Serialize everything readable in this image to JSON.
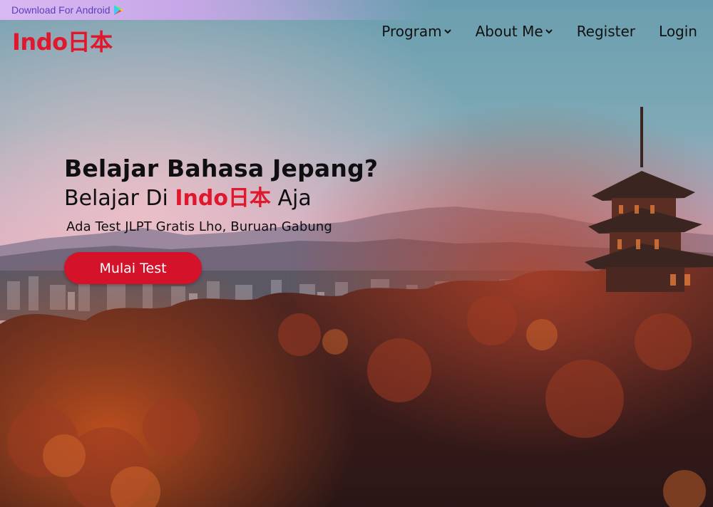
{
  "banner": {
    "label": "Download For Android",
    "icon": "google-play-icon"
  },
  "nav": {
    "logo": "Indo日本",
    "items": [
      {
        "label": "Program",
        "has_dropdown": true
      },
      {
        "label": "About Me",
        "has_dropdown": true
      },
      {
        "label": "Register",
        "has_dropdown": false
      },
      {
        "label": "Login",
        "has_dropdown": false
      }
    ]
  },
  "hero": {
    "headline": "Belajar Bahasa Jepang?",
    "line2_prefix": "Belajar Di ",
    "line2_brand": "Indo日本",
    "line2_suffix": " Aja",
    "subtitle": "Ada Test JLPT Gratis Lho, Buruan Gabung",
    "cta_label": "Mulai Test"
  },
  "colors": {
    "brand_red": "#e0182d",
    "cta_red": "#d4122a",
    "banner_text": "#5b3fbf"
  }
}
